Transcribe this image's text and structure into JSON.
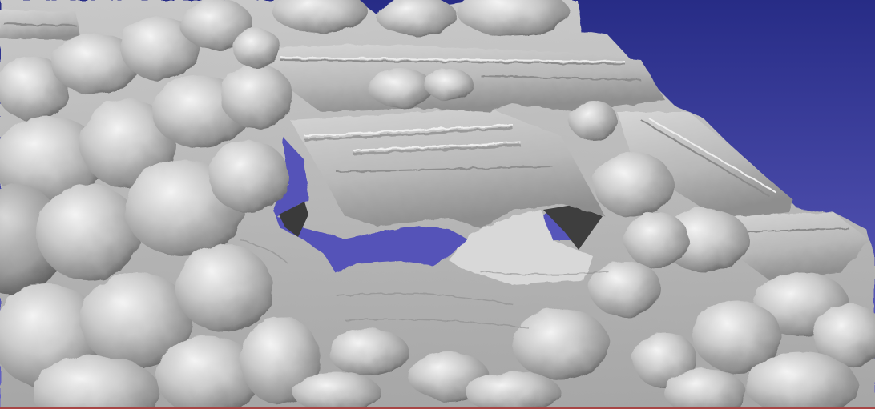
{
  "viewer": {
    "background_top": "#272c86",
    "background_bottom": "#6664c6",
    "mesh_color": "#bdbdbd",
    "mesh_shadow": "#3c3c3c",
    "mesh_highlight": "#f2f2f2",
    "bottom_strip_color": "#a84646"
  }
}
